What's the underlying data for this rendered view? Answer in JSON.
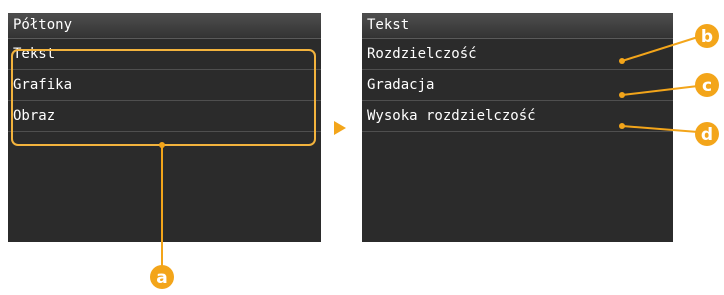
{
  "left_screen": {
    "title": "Półtony",
    "items": [
      "Tekst",
      "Grafika",
      "Obraz"
    ]
  },
  "right_screen": {
    "title": "Tekst",
    "items": [
      "Rozdzielczość",
      "Gradacja",
      "Wysoka rozdzielczość"
    ]
  },
  "callouts": {
    "a": "a",
    "b": "b",
    "c": "c",
    "d": "d"
  },
  "colors": {
    "accent": "#f3a51a",
    "screen_bg": "#2b2b2b",
    "text": "#ffffff"
  }
}
